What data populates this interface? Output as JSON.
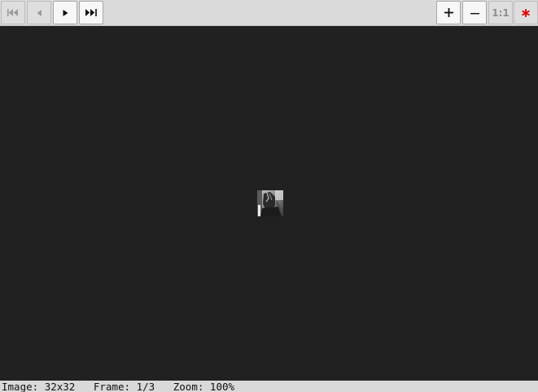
{
  "toolbar": {
    "playback": [
      {
        "name": "first-frame",
        "icon": "skip-to-start-icon",
        "enabled": false
      },
      {
        "name": "prev-frame",
        "icon": "step-back-icon",
        "enabled": false
      },
      {
        "name": "play",
        "icon": "play-icon",
        "enabled": true
      },
      {
        "name": "last-frame",
        "icon": "skip-to-end-icon",
        "enabled": true
      }
    ],
    "zoom": {
      "zoom_in_icon": "plus-icon",
      "zoom_out_icon": "minus-icon",
      "actual_size_label": "1:1",
      "fit_icon": "red-asterisk-icon"
    }
  },
  "status": {
    "image_label": "Image:",
    "image_size": "32x32",
    "frame_label": "Frame:",
    "frame_value": "1/3",
    "zoom_label": "Zoom:",
    "zoom_value": "100%"
  },
  "colors": {
    "canvas_bg": "#212121",
    "toolbar_bg": "#dadada",
    "disabled_icon": "#9a9a9a",
    "enabled_icon": "#111111",
    "fit_icon": "#e00000"
  }
}
